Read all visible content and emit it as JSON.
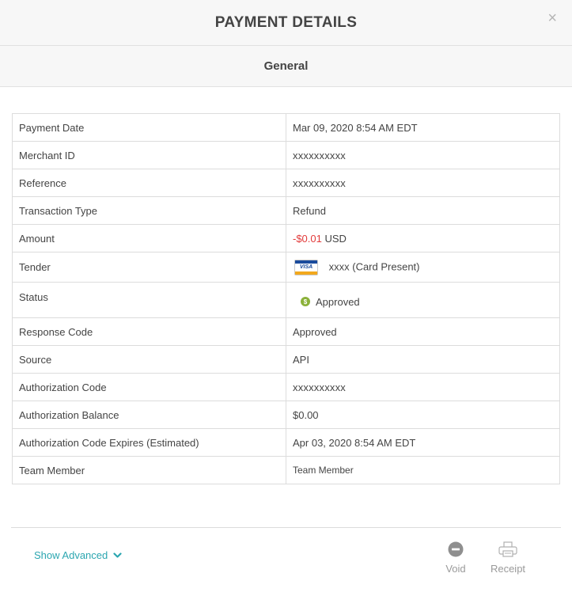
{
  "modal": {
    "title": "PAYMENT DETAILS",
    "close_label": "×",
    "section_title": "General"
  },
  "details": {
    "payment_date": {
      "label": "Payment Date",
      "value": "Mar 09, 2020 8:54 AM EDT"
    },
    "merchant_id": {
      "label": "Merchant ID",
      "value": "xxxxxxxxxx"
    },
    "reference": {
      "label": "Reference",
      "value": "xxxxxxxxxx"
    },
    "transaction_type": {
      "label": "Transaction Type",
      "value": "Refund"
    },
    "amount": {
      "label": "Amount",
      "value": "-$0.01",
      "currency": "USD"
    },
    "tender": {
      "label": "Tender",
      "card_brand": "VISA",
      "value": "xxxx (Card Present)"
    },
    "status": {
      "label": "Status",
      "value": "Approved",
      "icon_glyph": "$"
    },
    "response_code": {
      "label": "Response Code",
      "value": "Approved"
    },
    "source": {
      "label": "Source",
      "value": "API"
    },
    "authorization_code": {
      "label": "Authorization Code",
      "value": "xxxxxxxxxx"
    },
    "authorization_balance": {
      "label": "Authorization Balance",
      "value": "$0.00"
    },
    "authorization_code_expires": {
      "label": "Authorization Code Expires (Estimated)",
      "value": "Apr 03, 2020 8:54 AM EDT"
    },
    "team_member": {
      "label": "Team Member",
      "value": "Team Member"
    }
  },
  "footer": {
    "show_advanced_label": "Show Advanced",
    "void_label": "Void",
    "receipt_label": "Receipt"
  },
  "colors": {
    "accent": "#2ba6b0",
    "negative": "#e23b3b",
    "status_approved": "#8bb13a",
    "visa_blue": "#1a4b9c",
    "visa_gold": "#f2a81d"
  },
  "icons": {
    "close": "close-icon",
    "status": "dollar-circle-icon",
    "card": "visa-card-icon",
    "show_advanced": "chevron-down-icon",
    "void": "minus-circle-icon",
    "receipt": "printer-icon"
  }
}
